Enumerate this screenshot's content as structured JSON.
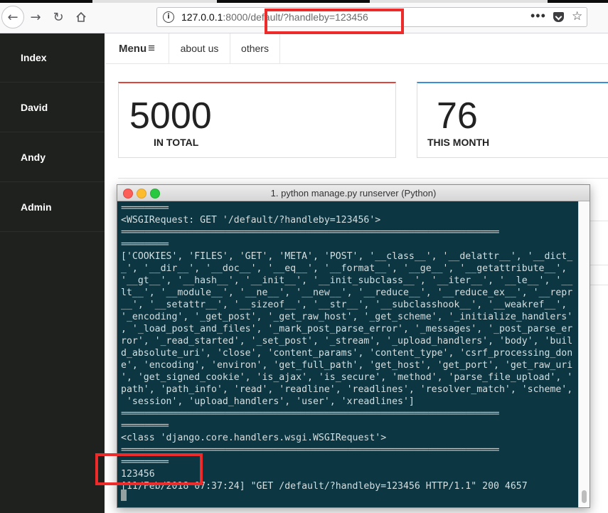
{
  "browser": {
    "url_host": "127.0.0.1",
    "url_rest": ":8000/default/?handleby=123456",
    "more_label": "•••"
  },
  "sidebar": {
    "items": [
      {
        "label": "Index"
      },
      {
        "label": "David"
      },
      {
        "label": "Andy"
      },
      {
        "label": "Admin"
      }
    ]
  },
  "topnav": {
    "menu_label": "Menu",
    "menu_icon": "≡",
    "items": [
      {
        "label": "about us"
      },
      {
        "label": "others"
      }
    ]
  },
  "cards": [
    {
      "value": "5000",
      "label": "IN TOTAL",
      "accent": "#e0443a"
    },
    {
      "value": "76",
      "label": "THIS MONTH",
      "accent": "#3a8fd9"
    }
  ],
  "terminal": {
    "title": "1. python manage.py runserver (Python)",
    "lines": [
      "==========",
      "<WSGIRequest: GET '/default/?handleby=123456'>",
      "================================================================================",
      "==========",
      "['COOKIES', 'FILES', 'GET', 'META', 'POST', '__class__', '__delattr__', '__dict_",
      "_', '__dir__', '__doc__', '__eq__', '__format__', '__ge__', '__getattribute__',",
      "'__gt__', '__hash__', '__init__', '__init_subclass__', '__iter__', '__le__', '__",
      "lt__', '__module__', '__ne__', '__new__', '__reduce__', '__reduce_ex__', '__repr",
      "__', '__setattr__', '__sizeof__', '__str__', '__subclasshook__', '__weakref__',",
      "'_encoding', '_get_post', '_get_raw_host', '_get_scheme', '_initialize_handlers'",
      ", '_load_post_and_files', '_mark_post_parse_error', '_messages', '_post_parse_er",
      "ror', '_read_started', '_set_post', '_stream', '_upload_handlers', 'body', 'buil",
      "d_absolute_uri', 'close', 'content_params', 'content_type', 'csrf_processing_don",
      "e', 'encoding', 'environ', 'get_full_path', 'get_host', 'get_port', 'get_raw_uri",
      "', 'get_signed_cookie', 'is_ajax', 'is_secure', 'method', 'parse_file_upload', '",
      "path', 'path_info', 'read', 'readline', 'readlines', 'resolver_match', 'scheme',",
      " 'session', 'upload_handlers', 'user', 'xreadlines']",
      "================================================================================",
      "==========",
      "<class 'django.core.handlers.wsgi.WSGIRequest'>",
      "================================================================================",
      "==========",
      "123456",
      "[11/Feb/2018 07:37:24] \"GET /default/?handleby=123456 HTTP/1.1\" 200 4657"
    ]
  }
}
